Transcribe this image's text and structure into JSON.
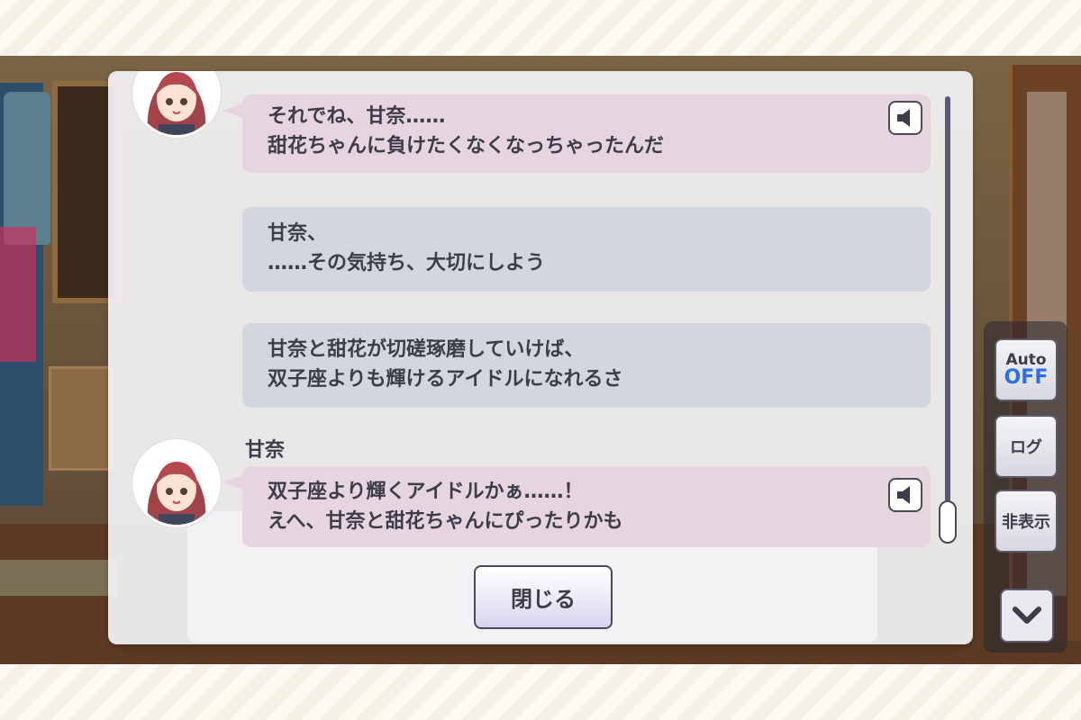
{
  "log": {
    "entries": [
      {
        "speaker": "",
        "style": "pink",
        "has_voice": true,
        "lines": [
          "それでね、甘奈……",
          "甜花ちゃんに負けたくなくなっちゃったんだ"
        ]
      },
      {
        "speaker": "",
        "style": "gray",
        "has_voice": false,
        "lines": [
          "甘奈、",
          "……その気持ち、大切にしよう"
        ]
      },
      {
        "speaker": "",
        "style": "gray",
        "has_voice": false,
        "lines": [
          "甘奈と甜花が切磋琢磨していけば、",
          "双子座よりも輝けるアイドルになれるさ"
        ]
      },
      {
        "speaker": "甘奈",
        "style": "pink",
        "has_voice": true,
        "lines": [
          "双子座より輝くアイドルかぁ……！",
          "えへ、甘奈と甜花ちゃんにぴったりかも"
        ]
      }
    ],
    "close_label": "閉じる"
  },
  "side_menu": {
    "auto_label": "Auto",
    "auto_state": "OFF",
    "log_label": "ログ",
    "hide_label": "非表示"
  },
  "colors": {
    "bubble_pink": "#e6d5df",
    "bubble_gray": "#d2d7df",
    "auto_off": "#2d6fe0"
  },
  "icons": {
    "voice": "speaker-icon",
    "collapse": "chevron-down-icon"
  }
}
